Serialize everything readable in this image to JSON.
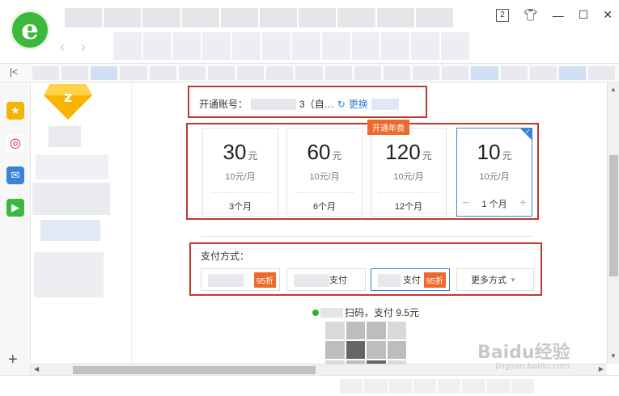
{
  "account": {
    "label": "开通账号：",
    "id_suffix": "3（自…",
    "change_label": "更换"
  },
  "plans": [
    {
      "price": "30",
      "unit": "元",
      "monthly": "10元/月",
      "duration": "3个月"
    },
    {
      "price": "60",
      "unit": "元",
      "monthly": "10元/月",
      "duration": "6个月"
    },
    {
      "price": "120",
      "unit": "元",
      "monthly": "10元/月",
      "duration": "12个月",
      "badge": "开通年费"
    },
    {
      "price": "10",
      "unit": "元",
      "monthly": "10元/月",
      "duration": "1 个月",
      "selected": true
    }
  ],
  "stepper": {
    "minus": "−",
    "plus": "+"
  },
  "payment": {
    "title": "支付方式：",
    "options": [
      {
        "label": "",
        "discount": "95折"
      },
      {
        "label": "支付",
        "discount": ""
      },
      {
        "label": "支付",
        "discount": "95折",
        "selected": true
      },
      {
        "label": "更多方式"
      }
    ]
  },
  "scan": {
    "text": "扫码，支付 9.5元"
  },
  "window": {
    "tab_count": "2"
  },
  "watermark": {
    "main": "Baidu经验",
    "sub": "jingyan.baidu.com"
  },
  "colors": {
    "accent": "#3a84d6",
    "highlight": "#c0392b",
    "discount": "#ef6a2a",
    "logo": "#3cb93c"
  }
}
